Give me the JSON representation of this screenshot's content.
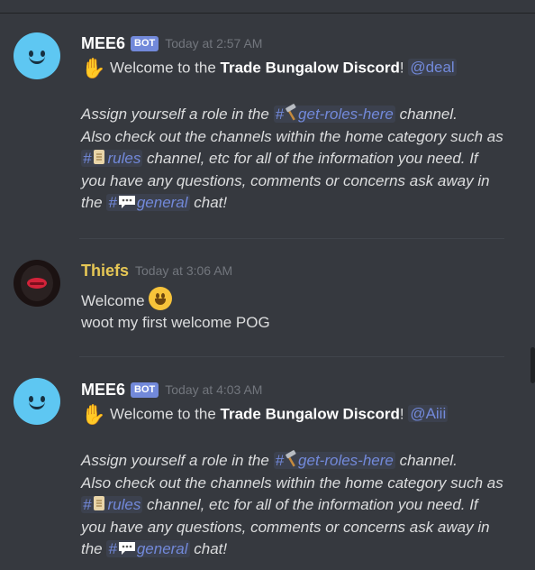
{
  "messages": [
    {
      "username": "MEE6",
      "badge": "BOT",
      "time": "Today at 2:57 AM",
      "welcome_prefix": "Welcome to the ",
      "welcome_bold": "Trade Bungalow Discord",
      "welcome_suffix": "!",
      "mention": "@deal",
      "l1_pre": "Assign yourself a role in the ",
      "l1_hash": "#",
      "l1_channel": "get-roles-here",
      "l1_post": " channel.",
      "l2": "Also check out the channels within the home category such as",
      "l3_hash": "#",
      "l3_channel": "rules",
      "l3_post": " channel, etc for all of the information you need. If",
      "l4": "you have any questions, comments or concerns ask away in",
      "l5_pre": "the ",
      "l5_hash": "#",
      "l5_channel": "general",
      "l5_post": " chat!"
    },
    {
      "username": "Thiefs",
      "time": "Today at 3:06 AM",
      "line1": "Welcome",
      "line2": "woot my first welcome POG"
    },
    {
      "username": "MEE6",
      "badge": "BOT",
      "time": "Today at 4:03 AM",
      "welcome_prefix": "Welcome to the ",
      "welcome_bold": "Trade Bungalow Discord",
      "welcome_suffix": "!",
      "mention": "@Aiii",
      "l1_pre": "Assign yourself a role in the ",
      "l1_hash": "#",
      "l1_channel": "get-roles-here",
      "l1_post": " channel.",
      "l2": "Also check out the channels within the home category such as",
      "l3_hash": "#",
      "l3_channel": "rules",
      "l3_post": " channel, etc for all of the information you need. If",
      "l4": "you have any questions, comments or concerns ask away in",
      "l5_pre": "the ",
      "l5_hash": "#",
      "l5_channel": "general",
      "l5_post": " chat!"
    }
  ],
  "colors": {
    "background": "#36393f",
    "mention": "#7289da",
    "bot_badge": "#7289da",
    "thiefs_name": "#e6c755",
    "timestamp": "#72767d"
  },
  "icons": [
    "waving-hand-icon",
    "hammer-icon",
    "scroll-icon",
    "speech-bubble-icon",
    "grinning-face-icon"
  ]
}
